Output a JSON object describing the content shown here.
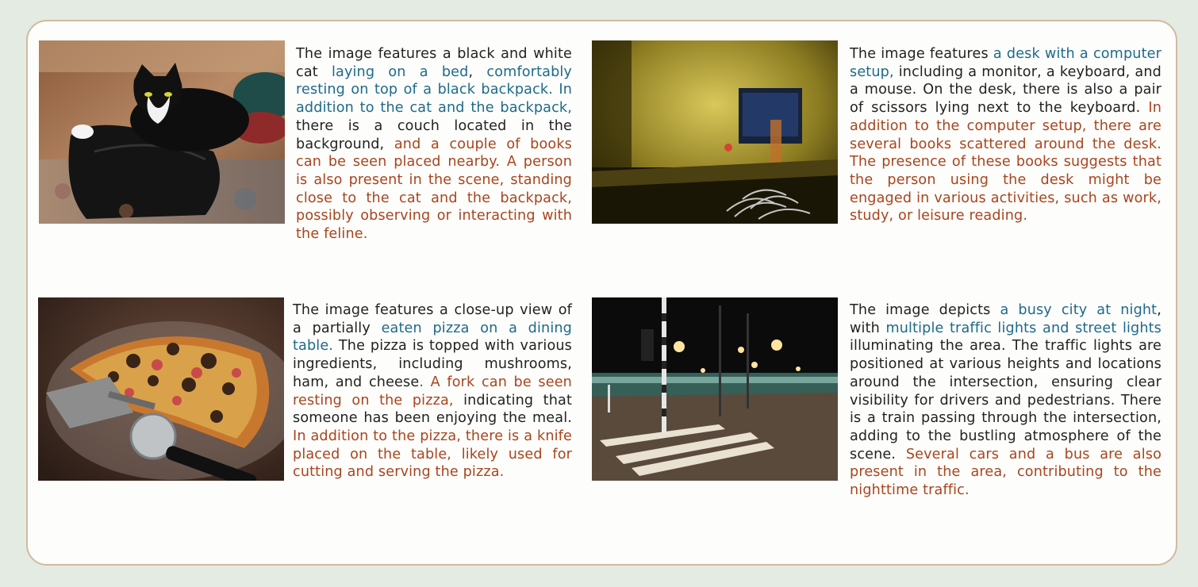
{
  "colors": {
    "panel_border": "#d3b9a0",
    "blue_highlight": "#1d6a8a",
    "red_highlight": "#a8451e"
  },
  "examples": [
    {
      "image": "photo of a black and white cat lying on a black backpack on a bed",
      "segments": [
        {
          "text": "The image features a black and white cat ",
          "style": "plain"
        },
        {
          "text": "laying on a bed",
          "style": "blue"
        },
        {
          "text": ", ",
          "style": "plain"
        },
        {
          "text": "comfortably resting on top of a black backpack. In addition to the cat and the backpack,",
          "style": "blue"
        },
        {
          "text": " there is a couch located in the background, ",
          "style": "plain"
        },
        {
          "text": "and a couple of books can be seen placed nearby. A person is also present in the scene, standing close to the cat and the backpack, possibly observing or interacting with the feline.",
          "style": "red"
        }
      ]
    },
    {
      "image": "blurred photo of a desk with a computer monitor and a pile of paper clips",
      "segments": [
        {
          "text": "The image features ",
          "style": "plain"
        },
        {
          "text": "a desk with a computer setup,",
          "style": "blue"
        },
        {
          "text": " including a monitor, a keyboard, and a mouse. On the desk, there is also a pair of scissors lying next to the keyboard. ",
          "style": "plain"
        },
        {
          "text": "In addition to the computer setup, there are several books scattered around the desk. The presence of these books suggests that the person using the desk might be engaged in various activities, such as work, study, or leisure reading.",
          "style": "red"
        }
      ]
    },
    {
      "image": "close-up photo of a partially eaten pizza with a server and pizza cutter",
      "segments": [
        {
          "text": "The image features a close-up view of a partially ",
          "style": "plain"
        },
        {
          "text": "eaten pizza on a dining table.",
          "style": "blue"
        },
        {
          "text": " The pizza is topped with various ingredients, including mushrooms, ham, and cheese",
          "style": "plain"
        },
        {
          "text": ".",
          "style": "blue"
        },
        {
          "text": " ",
          "style": "plain"
        },
        {
          "text": "A fork can be seen resting on the pizza,",
          "style": "red"
        },
        {
          "text": " indicating that someone has been enjoying the meal. ",
          "style": "plain"
        },
        {
          "text": "In addition to the pizza, there is a knife placed on the table, likely used for cutting and serving the pizza.",
          "style": "red"
        }
      ]
    },
    {
      "image": "night photo of a city intersection with traffic lights, street lights and a passing tram",
      "segments": [
        {
          "text": "The image depicts ",
          "style": "plain"
        },
        {
          "text": "a busy city at night",
          "style": "blue"
        },
        {
          "text": ", with ",
          "style": "plain"
        },
        {
          "text": "multiple traffic lights and street lights",
          "style": "blue"
        },
        {
          "text": " illuminating the area. The traffic lights are positioned at various heights and locations around the intersection, ensuring clear visibility for drivers and pedestrians. There is a train passing through the intersection, adding to the bustling atmosphere of the scene. ",
          "style": "plain"
        },
        {
          "text": "Several cars and a bus are also present in the area, contributing to the nighttime traffic.",
          "style": "red"
        }
      ]
    }
  ]
}
